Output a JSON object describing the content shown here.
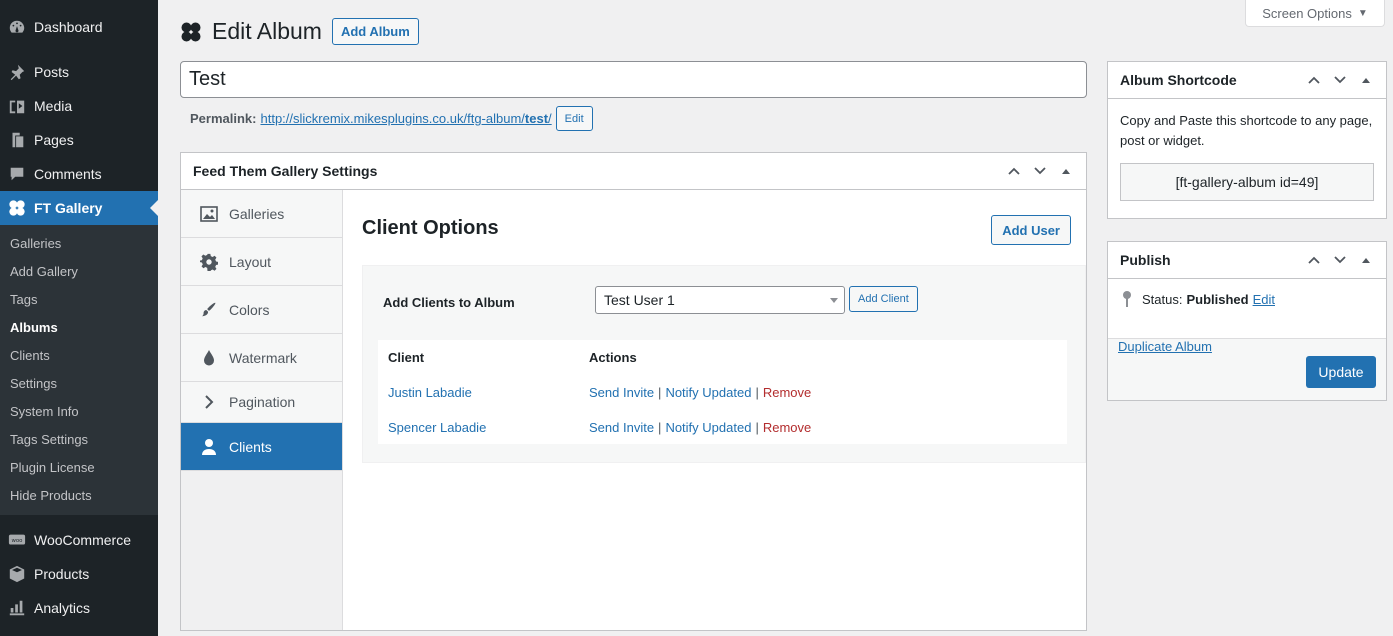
{
  "menu": {
    "top_items": [
      {
        "label": "Dashboard",
        "icon": "dashboard-icon"
      },
      {
        "label": "Posts",
        "icon": "pin-icon"
      },
      {
        "label": "Media",
        "icon": "media-icon"
      },
      {
        "label": "Pages",
        "icon": "pages-icon"
      },
      {
        "label": "Comments",
        "icon": "comments-icon"
      },
      {
        "label": "FT Gallery",
        "icon": "butterfly-icon"
      }
    ],
    "sub_items": [
      "Galleries",
      "Add Gallery",
      "Tags",
      "Albums",
      "Clients",
      "Settings",
      "System Info",
      "Tags Settings",
      "Plugin License",
      "Hide Products"
    ],
    "bottom_items": [
      {
        "label": "WooCommerce",
        "icon": "woocommerce-icon"
      },
      {
        "label": "Products",
        "icon": "products-icon"
      },
      {
        "label": "Analytics",
        "icon": "analytics-icon"
      }
    ]
  },
  "header": {
    "title": "Edit Album",
    "add_album": "Add Album",
    "screen_options": "Screen Options"
  },
  "post": {
    "title_value": "Test",
    "permalink_label": "Permalink:",
    "permalink_base": "http://slickremix.mikesplugins.co.uk/ftg-album/",
    "permalink_slug": "test",
    "permalink_trail": "/",
    "permalink_edit": "Edit"
  },
  "ftg": {
    "box_title": "Feed Them Gallery Settings",
    "tabs": [
      "Galleries",
      "Layout",
      "Colors",
      "Watermark",
      "Pagination",
      "Clients"
    ],
    "section_title": "Client Options",
    "add_user": "Add User",
    "add_clients_label": "Add Clients to Album",
    "select_value": "Test User 1",
    "add_client": "Add Client",
    "table": {
      "headers": [
        "Client",
        "Actions"
      ],
      "rows": [
        {
          "client": "Justin Labadie",
          "send": "Send Invite",
          "notify": "Notify Updated",
          "remove": "Remove"
        },
        {
          "client": "Spencer Labadie",
          "send": "Send Invite",
          "notify": "Notify Updated",
          "remove": "Remove"
        }
      ],
      "separator": "|"
    }
  },
  "shortcode": {
    "title": "Album Shortcode",
    "description": "Copy and Paste this shortcode to any page, post or widget.",
    "value": "[ft-gallery-album id=49]"
  },
  "publish": {
    "title": "Publish",
    "status_label": "Status:",
    "status_value": "Published",
    "status_edit": "Edit",
    "duplicate": "Duplicate Album",
    "update": "Update"
  },
  "colors": {
    "menu_bg": "#1d2327",
    "accent": "#2271b1",
    "danger": "#b32d2e"
  }
}
